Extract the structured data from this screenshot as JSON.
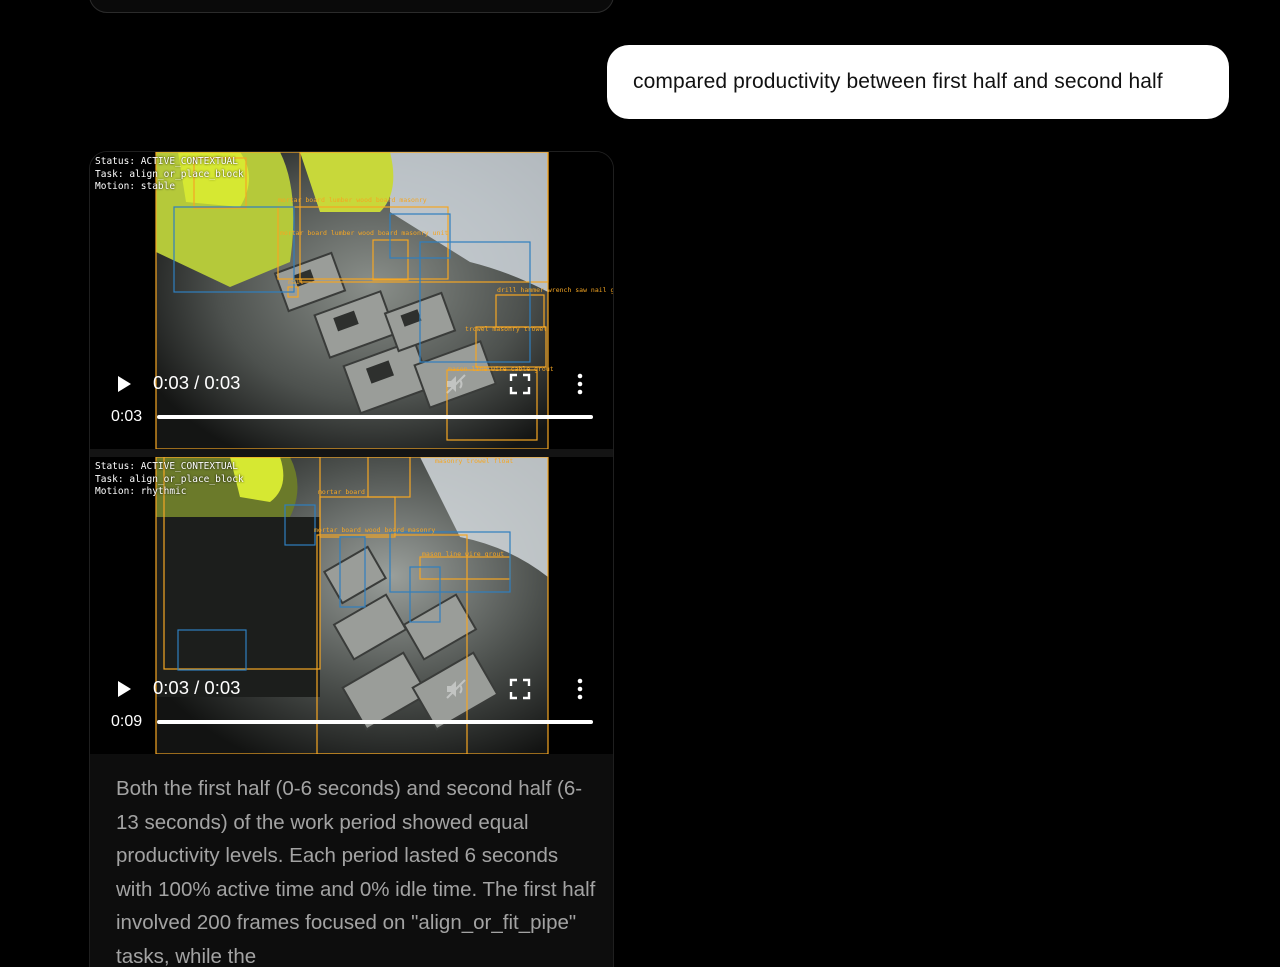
{
  "user_message": "compared productivity between first half and second half",
  "videos": [
    {
      "hud": {
        "status": "Status: ACTIVE_CONTEXTUAL",
        "task": "Task: align_or_place_block",
        "motion": "Motion: stable"
      },
      "detections": [
        "mortar board lumber wood board masonry",
        "mortar board lumber wood board masonry unit",
        "drill hammer wrench saw nail gun p",
        "trowel masonry trowel",
        "mason line wire cable grout",
        "nail"
      ],
      "time_display": "0:03 / 0:03",
      "seek_time": "0:03",
      "progress": 1.0
    },
    {
      "hud": {
        "status": "Status: ACTIVE_CONTEXTUAL",
        "task": "Task: align_or_place_block",
        "motion": "Motion: rhythmic"
      },
      "detections": [
        "masonry trowel float",
        "mortar board",
        "mortar board wood board masonry",
        "mason line wire grout"
      ],
      "time_display": "0:03 / 0:03",
      "seek_time": "0:09",
      "progress": 1.0
    }
  ],
  "response_text": "Both the first half (0-6 seconds) and second half (6-13 seconds) of the work period showed equal productivity levels. Each period lasted 6 seconds with 100% active time and 0% idle time. The first half involved 200 frames focused on \"align_or_fit_pipe\" tasks, while the",
  "icons": {
    "play": "play-icon",
    "mute": "volume-muted-icon",
    "fullscreen": "fullscreen-icon",
    "more": "more-vertical-icon"
  },
  "colors": {
    "detection_box": "#f5a623",
    "secondary_box": "#2f7fbf",
    "hi_vis_vest": "#d6e832"
  }
}
